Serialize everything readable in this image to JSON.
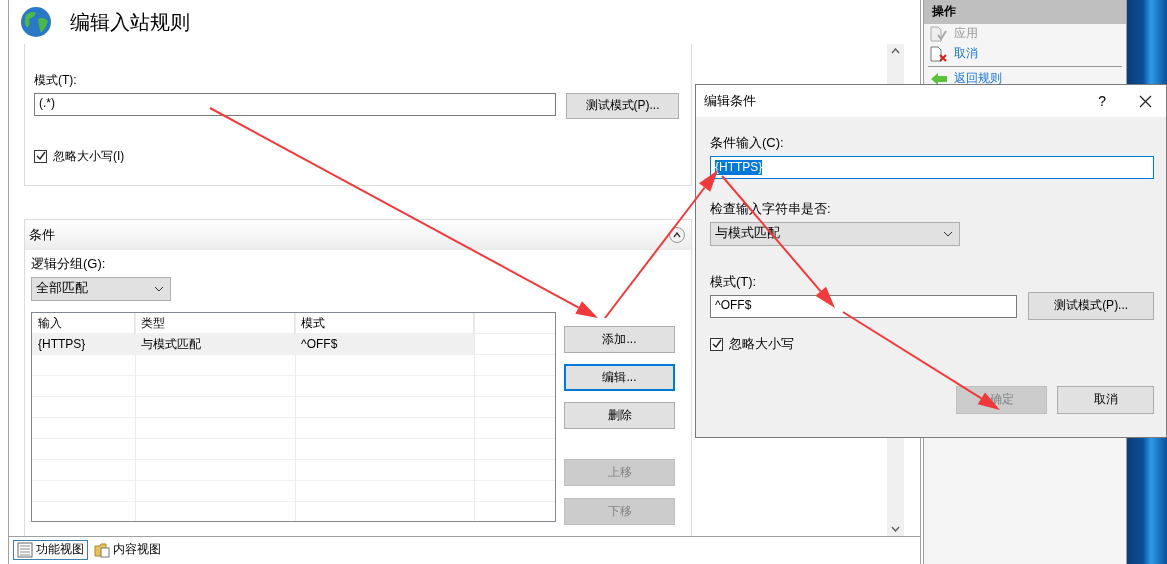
{
  "window": {
    "title": "编辑入站规则"
  },
  "pattern_section": {
    "label": "模式(T):",
    "value": "(.*)",
    "test_button": "测试模式(P)...",
    "ignore_case": {
      "label": "忽略大小写(I)",
      "checked": true
    }
  },
  "conditions": {
    "title": "条件",
    "expanded": true,
    "grouping_label": "逻辑分组(G):",
    "grouping_value": "全部匹配",
    "columns": [
      "输入",
      "类型",
      "模式"
    ],
    "rows": [
      {
        "cells": [
          "{HTTPS}",
          "与模式匹配",
          "^OFF$"
        ],
        "selected": true
      }
    ],
    "buttons": [
      {
        "label": "添加...",
        "disabled": false,
        "focused": false
      },
      {
        "label": "编辑...",
        "disabled": false,
        "focused": true
      },
      {
        "label": "删除",
        "disabled": false,
        "focused": false
      },
      {
        "label": "上移",
        "disabled": true,
        "focused": false
      },
      {
        "label": "下移",
        "disabled": true,
        "focused": false
      }
    ]
  },
  "view_tabs": [
    {
      "label": "功能视图",
      "selected": true,
      "kind": "features"
    },
    {
      "label": "内容视图",
      "selected": false,
      "kind": "content"
    }
  ],
  "actions": {
    "title": "操作",
    "items": [
      {
        "label": "应用",
        "disabled": true,
        "kind": "apply"
      },
      {
        "label": "取消",
        "disabled": false,
        "kind": "cancel"
      },
      {
        "label": "返回规则",
        "disabled": false,
        "kind": "back"
      }
    ]
  },
  "dialog": {
    "title": "编辑条件",
    "help": "?",
    "input_label": "条件输入(C):",
    "input_value": "{HTTPS}",
    "input_selected": true,
    "check_label": "检查输入字符串是否:",
    "check_value": "与模式匹配",
    "pattern_label": "模式(T):",
    "pattern_value": "^OFF$",
    "test_button": "测试模式(P)...",
    "ignore_case": {
      "label": "忽略大小写",
      "checked": true
    },
    "ok": {
      "label": "确定",
      "disabled": true
    },
    "cancel": {
      "label": "取消",
      "disabled": false
    }
  }
}
